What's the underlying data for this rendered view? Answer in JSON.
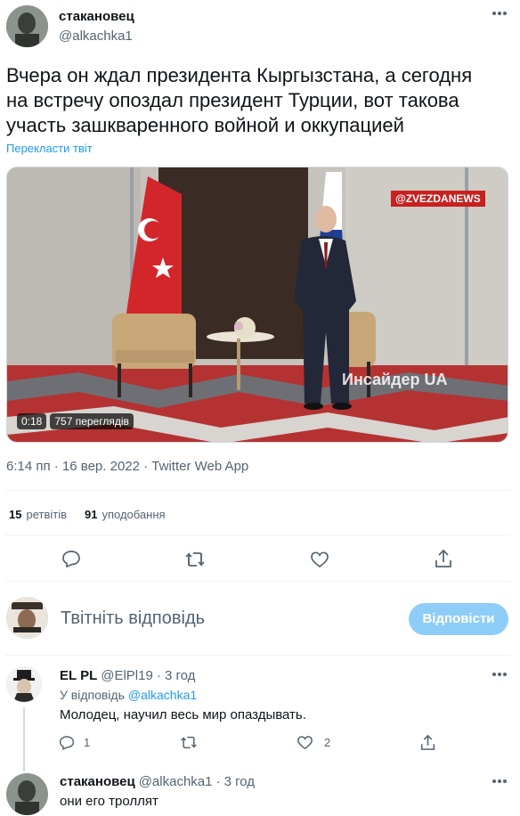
{
  "tweet": {
    "author_name": "стакановец",
    "author_handle": "@alkachka1",
    "text_lines": [
      "Вчера он ждал президента Кыргызстана, а сегодня",
      "на встречу опоздал президент Турции, вот такова",
      "участь зашкваренного  войной  и оккупацией"
    ],
    "translate": "Перекласти твіт",
    "video": {
      "watermark_top": "@ZVEZDANEWS",
      "watermark_bottom": "Инсайдер UA",
      "duration": "0:18",
      "views": "757 переглядів"
    },
    "meta": "6:14 пп · 16 вер. 2022 · Twitter Web App",
    "retweets_count": "15",
    "retweets_label": "ретвітів",
    "likes_count": "91",
    "likes_label": "уподобання"
  },
  "reply_box": {
    "placeholder": "Твітніть відповідь",
    "button": "Відповісти"
  },
  "replies": [
    {
      "name": "EL PL",
      "handle": "@ElPl19",
      "time": "· 3 год",
      "replying_prefix": "У відповідь",
      "replying_to": "@alkachka1",
      "text": "Молодец, научил весь мир опаздывать.",
      "replies_count": "1",
      "likes_count": "2"
    },
    {
      "name": "стакановец",
      "handle": "@alkachka1",
      "time": "· 3 год",
      "text": "они его троллят"
    }
  ],
  "colors": {
    "accent": "#1d9bf0",
    "button_disabled": "#8ecdf8",
    "secondary_text": "#536471"
  }
}
